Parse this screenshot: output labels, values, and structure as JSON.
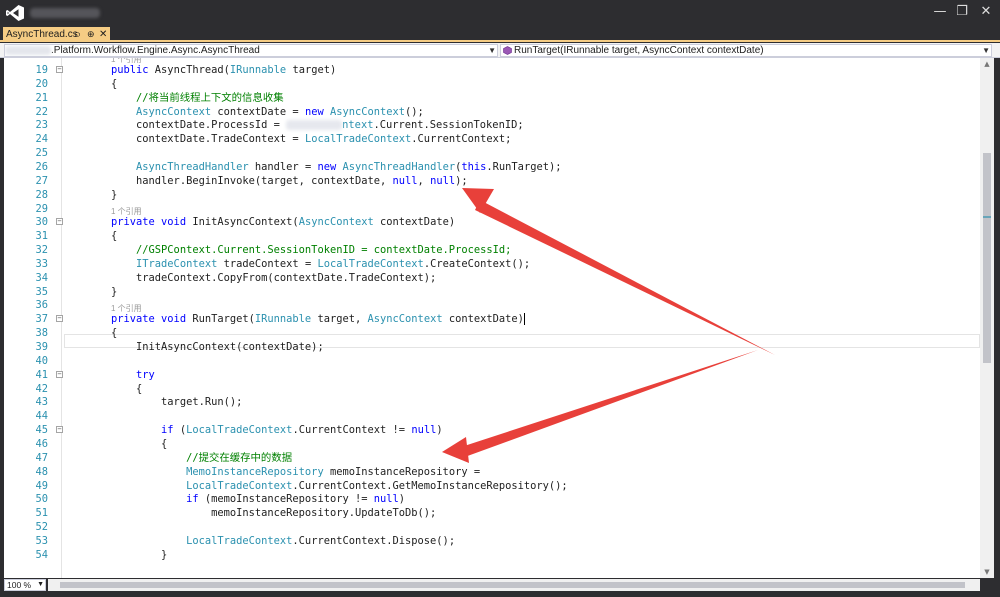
{
  "window": {
    "minimize_glyph": "—",
    "restore_glyph": "❐",
    "close_glyph": "✕"
  },
  "tab": {
    "name": "AsyncThread.cs",
    "pin_glyph": "⊐",
    "pin_glyph2": "⊕",
    "close_glyph": "✕"
  },
  "navbar": {
    "type_selector": ".Platform.Workflow.Engine.Async.AsyncThread",
    "member_selector": "RunTarget(IRunnable target, AsyncContext contextDate)"
  },
  "code": {
    "codelens_ref": "1 个引用",
    "lines": [
      {
        "n": "19",
        "tokens": [
          {
            "t": "kw",
            "v": "public "
          },
          {
            "t": "tx",
            "v": "AsyncThread("
          },
          {
            "t": "ty",
            "v": "IRunnable"
          },
          {
            "t": "tx",
            "v": " target)"
          }
        ]
      },
      {
        "n": "20",
        "tokens": [
          {
            "t": "tx",
            "v": "{"
          }
        ]
      },
      {
        "n": "21",
        "tokens": [
          {
            "t": "cm",
            "v": "    //将当前线程上下文的信息收集"
          }
        ]
      },
      {
        "n": "22",
        "tokens": [
          {
            "t": "ty",
            "v": "    AsyncContext"
          },
          {
            "t": "tx",
            "v": " contextDate = "
          },
          {
            "t": "kw",
            "v": "new "
          },
          {
            "t": "ty",
            "v": "AsyncContext"
          },
          {
            "t": "tx",
            "v": "();"
          }
        ]
      },
      {
        "n": "23",
        "tokens": [
          {
            "t": "tx",
            "v": "    contextDate.ProcessId = "
          },
          {
            "t": "blur",
            "v": ""
          },
          {
            "t": "ty",
            "v": "ntext"
          },
          {
            "t": "tx",
            "v": ".Current.SessionTokenID;"
          }
        ]
      },
      {
        "n": "24",
        "tokens": [
          {
            "t": "tx",
            "v": "    contextDate.TradeContext = "
          },
          {
            "t": "ty",
            "v": "LocalTradeContext"
          },
          {
            "t": "tx",
            "v": ".CurrentContext;"
          }
        ]
      },
      {
        "n": "25",
        "tokens": []
      },
      {
        "n": "26",
        "tokens": [
          {
            "t": "ty",
            "v": "    AsyncThreadHandler"
          },
          {
            "t": "tx",
            "v": " handler = "
          },
          {
            "t": "kw",
            "v": "new "
          },
          {
            "t": "ty",
            "v": "AsyncThreadHandler"
          },
          {
            "t": "tx",
            "v": "("
          },
          {
            "t": "kw",
            "v": "this"
          },
          {
            "t": "tx",
            "v": ".RunTarget);"
          }
        ]
      },
      {
        "n": "27",
        "tokens": [
          {
            "t": "tx",
            "v": "    handler.BeginInvoke(target, contextDate, "
          },
          {
            "t": "kw",
            "v": "null"
          },
          {
            "t": "tx",
            "v": ", "
          },
          {
            "t": "kw",
            "v": "null"
          },
          {
            "t": "tx",
            "v": ");"
          }
        ]
      },
      {
        "n": "28",
        "tokens": [
          {
            "t": "tx",
            "v": "}"
          }
        ]
      },
      {
        "n": "29",
        "tokens": []
      },
      {
        "n": "30",
        "tokens": [
          {
            "t": "kw",
            "v": "private void "
          },
          {
            "t": "tx",
            "v": "InitAsyncContext("
          },
          {
            "t": "ty",
            "v": "AsyncContext"
          },
          {
            "t": "tx",
            "v": " contextDate)"
          }
        ]
      },
      {
        "n": "31",
        "tokens": [
          {
            "t": "tx",
            "v": "{"
          }
        ]
      },
      {
        "n": "32",
        "tokens": [
          {
            "t": "cm",
            "v": "    //GSPContext.Current.SessionTokenID = contextDate.ProcessId;"
          }
        ]
      },
      {
        "n": "33",
        "tokens": [
          {
            "t": "ty",
            "v": "    ITradeContext"
          },
          {
            "t": "tx",
            "v": " tradeContext = "
          },
          {
            "t": "ty",
            "v": "LocalTradeContext"
          },
          {
            "t": "tx",
            "v": ".CreateContext();"
          }
        ]
      },
      {
        "n": "34",
        "tokens": [
          {
            "t": "tx",
            "v": "    tradeContext.CopyFrom(contextDate.TradeContext);"
          }
        ]
      },
      {
        "n": "35",
        "tokens": [
          {
            "t": "tx",
            "v": "}"
          }
        ]
      },
      {
        "n": "36",
        "tokens": []
      },
      {
        "n": "37",
        "tokens": [
          {
            "t": "kw",
            "v": "private void "
          },
          {
            "t": "tx",
            "v": "RunTarget("
          },
          {
            "t": "ty",
            "v": "IRunnable"
          },
          {
            "t": "tx",
            "v": " target, "
          },
          {
            "t": "ty",
            "v": "AsyncContext"
          },
          {
            "t": "tx",
            "v": " contextDate)"
          },
          {
            "t": "caret",
            "v": ""
          }
        ]
      },
      {
        "n": "38",
        "tokens": [
          {
            "t": "tx",
            "v": "{"
          }
        ]
      },
      {
        "n": "39",
        "tokens": [
          {
            "t": "tx",
            "v": "    InitAsyncContext(contextDate);"
          }
        ]
      },
      {
        "n": "40",
        "tokens": []
      },
      {
        "n": "41",
        "tokens": [
          {
            "t": "kw",
            "v": "    try"
          }
        ]
      },
      {
        "n": "42",
        "tokens": [
          {
            "t": "tx",
            "v": "    {"
          }
        ]
      },
      {
        "n": "43",
        "tokens": [
          {
            "t": "tx",
            "v": "        target.Run();"
          }
        ]
      },
      {
        "n": "44",
        "tokens": []
      },
      {
        "n": "45",
        "tokens": [
          {
            "t": "kw",
            "v": "        if "
          },
          {
            "t": "tx",
            "v": "("
          },
          {
            "t": "ty",
            "v": "LocalTradeContext"
          },
          {
            "t": "tx",
            "v": ".CurrentContext != "
          },
          {
            "t": "kw",
            "v": "null"
          },
          {
            "t": "tx",
            "v": ")"
          }
        ]
      },
      {
        "n": "46",
        "tokens": [
          {
            "t": "tx",
            "v": "        {"
          }
        ]
      },
      {
        "n": "47",
        "tokens": [
          {
            "t": "cm",
            "v": "            //提交在缓存中的数据"
          }
        ]
      },
      {
        "n": "48",
        "tokens": [
          {
            "t": "ty",
            "v": "            MemoInstanceRepository"
          },
          {
            "t": "tx",
            "v": " memoInstanceRepository ="
          }
        ]
      },
      {
        "n": "49",
        "tokens": [
          {
            "t": "ty",
            "v": "            LocalTradeContext"
          },
          {
            "t": "tx",
            "v": ".CurrentContext.GetMemoInstanceRepository();"
          }
        ]
      },
      {
        "n": "50",
        "tokens": [
          {
            "t": "kw",
            "v": "            if "
          },
          {
            "t": "tx",
            "v": "(memoInstanceRepository != "
          },
          {
            "t": "kw",
            "v": "null"
          },
          {
            "t": "tx",
            "v": ")"
          }
        ]
      },
      {
        "n": "51",
        "tokens": [
          {
            "t": "tx",
            "v": "                memoInstanceRepository.UpdateToDb();"
          }
        ]
      },
      {
        "n": "52",
        "tokens": []
      },
      {
        "n": "53",
        "tokens": [
          {
            "t": "ty",
            "v": "            LocalTradeContext"
          },
          {
            "t": "tx",
            "v": ".CurrentContext.Dispose();"
          }
        ]
      },
      {
        "n": "54",
        "tokens": [
          {
            "t": "tx",
            "v": "        }"
          }
        ]
      }
    ]
  },
  "status": {
    "zoom": "100 %"
  },
  "colors": {
    "keyword": "#0000ff",
    "type": "#2b91af",
    "comment": "#008000",
    "annotation_arrow": "#e8403a",
    "tab_active": "#f5cc84"
  },
  "icons": {
    "app": "visual-studio-logo-icon",
    "namespace": "class-icon",
    "method": "method-icon"
  }
}
